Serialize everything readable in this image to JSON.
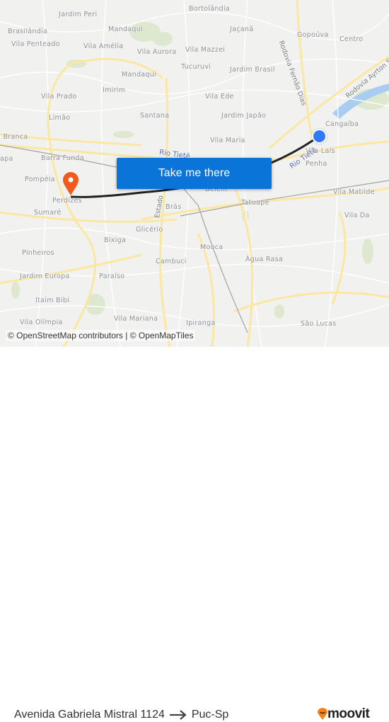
{
  "map": {
    "labels": [
      "Jardim Peri",
      "Bortolândia",
      "Brasilândia",
      "Mandaqui",
      "Jaçanã",
      "Gopoúva",
      "Centro",
      "Vila Penteado",
      "Vila Amélia",
      "Vila Aurora",
      "Vila Mazzei",
      "Tucuruvi",
      "Jardim Brasil",
      "Mandaqui",
      "Imirim",
      "Vila Prado",
      "Vila Ede",
      "Limão",
      "Santana",
      "Jardim Japão",
      "Cangaíba",
      "a Branca",
      "Vila Maria",
      "Vila Laís",
      "Barra Funda",
      "apa",
      "Penha",
      "Pompéia",
      "Perdizes",
      "Belém",
      "Vila Matilde",
      "Brás",
      "Tatuapé",
      "Sumaré",
      "Vila Da",
      "Glicério",
      "Bixiga",
      "Mooca",
      "Pinheiros",
      "Cambuci",
      "Água Rasa",
      "Jardim Europa",
      "Paraíso",
      "Itaim Bibi",
      "Vila Mariana",
      "Vila Olímpia",
      "Ipiranga",
      "São Lucas"
    ],
    "roads": {
      "fernao_dias": "Rodovia Fernão Dias",
      "ayrton": "Rodovia Ayrton S",
      "estado": "Estado"
    },
    "rivers": {
      "tiete1": "Rio Tietê",
      "tiete2": "Rio Tietê"
    },
    "origin_marker": "blue-dot",
    "destination_marker": "orange-pin",
    "colors": {
      "route": "#222222",
      "origin": "#2f7bf5",
      "destination": "#f05a1e",
      "button": "#0a74d8",
      "major_road": "#fbe7a1"
    }
  },
  "cta_label": "Take me there",
  "attribution": "© OpenStreetMap contributors | © OpenMapTiles",
  "footer": {
    "origin": "Avenida Gabriela Mistral 1124",
    "destination": "Puc-Sp",
    "brand": "moovit"
  }
}
